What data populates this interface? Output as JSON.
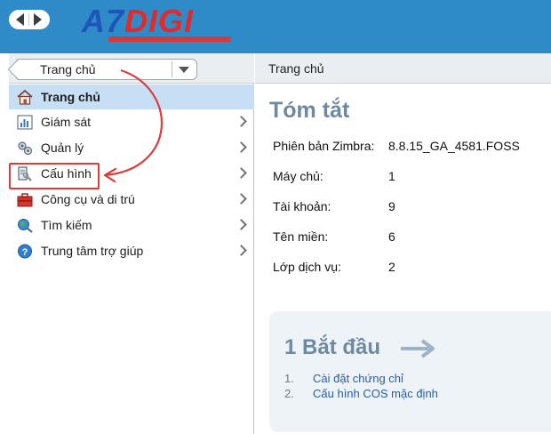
{
  "header": {
    "logo_text_a": "A7",
    "logo_text_b": "DIGI",
    "brand_colors": {
      "logo_blue": "#1d55b8",
      "logo_red": "#e32a2a",
      "header_bg": "#2f8ac8"
    }
  },
  "nav": {
    "back_icon": "triangle-left-icon",
    "forward_icon": "triangle-right-icon"
  },
  "left_panel": {
    "breadcrumb_label": "Trang chủ",
    "menu": [
      {
        "label": "Trang chủ",
        "icon": "home-icon",
        "selected": true,
        "has_submenu": false
      },
      {
        "label": "Giám sát",
        "icon": "monitor-chart-icon",
        "selected": false,
        "has_submenu": true
      },
      {
        "label": "Quản lý",
        "icon": "manage-gears-icon",
        "selected": false,
        "has_submenu": true
      },
      {
        "label": "Cấu hình",
        "icon": "configure-icon",
        "selected": false,
        "has_submenu": true,
        "highlighted": true
      },
      {
        "label": "Công cụ và di trú",
        "icon": "toolbox-icon",
        "selected": false,
        "has_submenu": true
      },
      {
        "label": "Tìm kiếm",
        "icon": "search-globe-icon",
        "selected": false,
        "has_submenu": true
      },
      {
        "label": "Trung tâm trợ giúp",
        "icon": "help-icon",
        "selected": false,
        "has_submenu": true
      }
    ]
  },
  "right_panel": {
    "header_label": "Trang chủ",
    "summary_title": "Tóm tắt",
    "info": [
      {
        "label": "Phiên bản Zimbra:",
        "value": "8.8.15_GA_4581.FOSS"
      },
      {
        "label": "Máy chủ:",
        "value": "1"
      },
      {
        "label": "Tài khoản:",
        "value": "9"
      },
      {
        "label": "Tên miền:",
        "value": "6"
      },
      {
        "label": "Lớp dịch vụ:",
        "value": "2"
      }
    ],
    "getting_started": {
      "title": "1 Bắt đầu",
      "steps": [
        {
          "num": "1.",
          "label": "Cài đặt chứng chỉ"
        },
        {
          "num": "2.",
          "label": "Cấu hình COS mặc định"
        }
      ]
    }
  },
  "colors": {
    "selected_bg": "#c6dff5",
    "annotation_red": "#e13a3a",
    "link": "#2b5d9c",
    "heading": "#6e8aa3"
  }
}
